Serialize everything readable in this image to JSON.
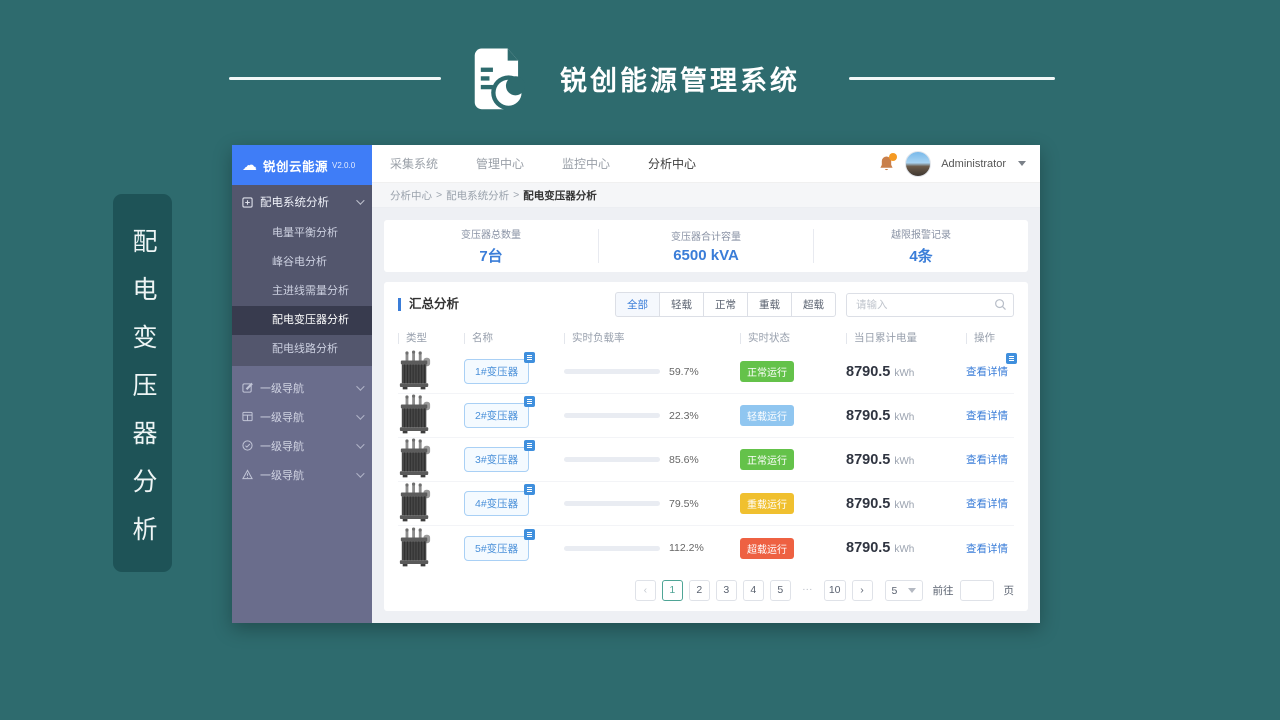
{
  "colors": {
    "canvas_teal": "#2e6b6e",
    "side_label_teal": "#1e5357",
    "sidebar_purple": "#6a6d8c",
    "logo_blue": "#3f7df7",
    "accent_blue": "#3a7dd8",
    "status_normal_green": "#64c24a",
    "status_light_blue": "#90c6f0",
    "status_heavy_yellow": "#f0c02f",
    "status_over_red": "#ee6142",
    "pagination_active_teal": "#4fa596"
  },
  "brand": {
    "title": "锐创能源管理系统",
    "side_label": "配电变压器分析"
  },
  "app": {
    "sidebar": {
      "logo_text": "锐创云能源",
      "version": "V2.0.0",
      "group": {
        "label": "配电系统分析",
        "children": [
          "电量平衡分析",
          "峰谷电分析",
          "主进线需量分析",
          "配电变压器分析",
          "配电线路分析"
        ],
        "active_index": 3
      },
      "nav_items": [
        "一级导航",
        "一级导航",
        "一级导航",
        "一级导航"
      ]
    },
    "topnav": {
      "items": [
        "采集系统",
        "管理中心",
        "监控中心",
        "分析中心"
      ],
      "active_index": 3,
      "username": "Administrator"
    },
    "breadcrumb": {
      "parts": [
        "分析中心",
        "配电系统分析",
        "配电变压器分析"
      ],
      "separator": ">"
    },
    "stats": [
      {
        "label": "变压器总数量",
        "value": "7台"
      },
      {
        "label": "变压器合计容量",
        "value": "6500 kVA"
      },
      {
        "label": "越限报警记录",
        "value": "4条"
      }
    ],
    "summary": {
      "title": "汇总分析",
      "filters": [
        "全部",
        "轻载",
        "正常",
        "重载",
        "超载"
      ],
      "active_filter_index": 0,
      "search_placeholder": "请输入",
      "table": {
        "headers": [
          "类型",
          "名称",
          "实时负载率",
          "实时状态",
          "当日累计电量",
          "操作"
        ],
        "rows": [
          {
            "name": "1#变压器",
            "load": "59.7%",
            "load_pct": 59.7,
            "status": "正常运行",
            "status_class": "ok",
            "energy": "8790.5",
            "unit": "kWh",
            "action": "查看详情",
            "action_badge": true
          },
          {
            "name": "2#变压器",
            "load": "22.3%",
            "load_pct": 22.3,
            "status": "轻载运行",
            "status_class": "light",
            "energy": "8790.5",
            "unit": "kWh",
            "action": "查看详情",
            "action_badge": false
          },
          {
            "name": "3#变压器",
            "load": "85.6%",
            "load_pct": 85.6,
            "status": "正常运行",
            "status_class": "ok",
            "energy": "8790.5",
            "unit": "kWh",
            "action": "查看详情",
            "action_badge": false
          },
          {
            "name": "4#变压器",
            "load": "79.5%",
            "load_pct": 79.5,
            "status": "重载运行",
            "status_class": "heavy",
            "energy": "8790.5",
            "unit": "kWh",
            "action": "查看详情",
            "action_badge": false
          },
          {
            "name": "5#变压器",
            "load": "112.2%",
            "load_pct": 112.2,
            "status": "超载运行",
            "status_class": "over",
            "energy": "8790.5",
            "unit": "kWh",
            "action": "查看详情",
            "action_badge": false
          }
        ]
      },
      "pagination": {
        "prev": "‹",
        "pages": [
          "1",
          "2",
          "3",
          "4",
          "5",
          "···",
          "10"
        ],
        "active_page": "1",
        "next": "›",
        "page_size": "5",
        "goto_label": "前往",
        "goto_unit": "页"
      }
    }
  }
}
